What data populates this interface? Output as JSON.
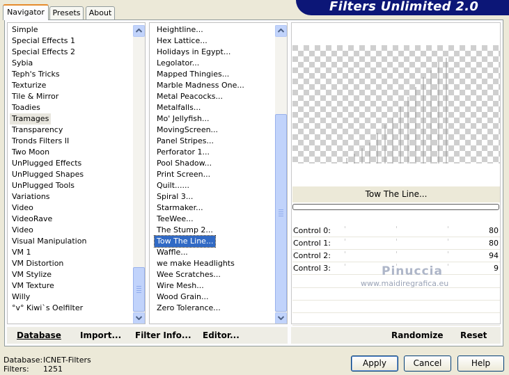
{
  "tabs": [
    "Navigator",
    "Presets",
    "About"
  ],
  "banner_title": "Filters Unlimited 2.0",
  "categories": [
    {
      "label": "Simple"
    },
    {
      "label": "Special Effects 1"
    },
    {
      "label": "Special Effects 2"
    },
    {
      "label": "Sybia"
    },
    {
      "label": "Teph's Tricks"
    },
    {
      "label": "Texturize"
    },
    {
      "label": "Tile & Mirror"
    },
    {
      "label": "Toadies"
    },
    {
      "label": "Tramages",
      "state": "current"
    },
    {
      "label": "Transparency"
    },
    {
      "label": "Tronds Filters II"
    },
    {
      "label": "Two Moon"
    },
    {
      "label": "UnPlugged Effects"
    },
    {
      "label": "UnPlugged Shapes"
    },
    {
      "label": "UnPlugged Tools"
    },
    {
      "label": "Variations"
    },
    {
      "label": "Video"
    },
    {
      "label": "VideoRave"
    },
    {
      "label": "Video"
    },
    {
      "label": "Visual Manipulation"
    },
    {
      "label": "VM 1"
    },
    {
      "label": "VM Distortion"
    },
    {
      "label": "VM Stylize"
    },
    {
      "label": "VM Texture"
    },
    {
      "label": "Willy"
    },
    {
      "label": "°v° Kiwi`s Oelfilter"
    }
  ],
  "filters": [
    {
      "label": "Heightline..."
    },
    {
      "label": "Hex Lattice..."
    },
    {
      "label": "Holidays in Egypt..."
    },
    {
      "label": "Legolator..."
    },
    {
      "label": "Mapped Thingies..."
    },
    {
      "label": "Marble Madness One..."
    },
    {
      "label": "Metal Peacocks..."
    },
    {
      "label": "Metalfalls..."
    },
    {
      "label": "Mo' Jellyfish..."
    },
    {
      "label": "MovingScreen..."
    },
    {
      "label": "Panel Stripes..."
    },
    {
      "label": "Perforator 1..."
    },
    {
      "label": "Pool Shadow..."
    },
    {
      "label": "Print Screen..."
    },
    {
      "label": "Quilt......"
    },
    {
      "label": "Spiral 3..."
    },
    {
      "label": "Starmaker..."
    },
    {
      "label": "TeeWee..."
    },
    {
      "label": "The Stump 2..."
    },
    {
      "label": "Tow The Line...",
      "state": "selected"
    },
    {
      "label": "Waffle..."
    },
    {
      "label": "we make Headlights"
    },
    {
      "label": "Wee Scratches..."
    },
    {
      "label": "Wire Mesh..."
    },
    {
      "label": "Wood Grain..."
    },
    {
      "label": "Zero Tolerance..."
    }
  ],
  "preview": {
    "filter_name": "Tow The Line..."
  },
  "controls": [
    {
      "label": "Control 0:",
      "value": "80"
    },
    {
      "label": "Control 1:",
      "value": "80"
    },
    {
      "label": "Control 2:",
      "value": "94"
    },
    {
      "label": "Control 3:",
      "value": "9"
    }
  ],
  "watermark": {
    "name": "Pinuccia",
    "url": "www.maidiregrafica.eu"
  },
  "bottom_left": {
    "database": "Database",
    "import": "Import...",
    "filter_info": "Filter Info...",
    "editor": "Editor..."
  },
  "bottom_right": {
    "randomize": "Randomize",
    "reset": "Reset"
  },
  "status": {
    "database_label": "Database:",
    "database_value": "ICNET-Filters",
    "filters_label": "Filters:",
    "filters_value": "1251"
  },
  "buttons": {
    "apply": "Apply",
    "cancel": "Cancel",
    "help": "Help"
  },
  "colors": {
    "banner": "#0c1677",
    "selection": "#316ac5",
    "scrollbar": "#c1d3fb",
    "active_tab_accent": "#e68b2c"
  }
}
